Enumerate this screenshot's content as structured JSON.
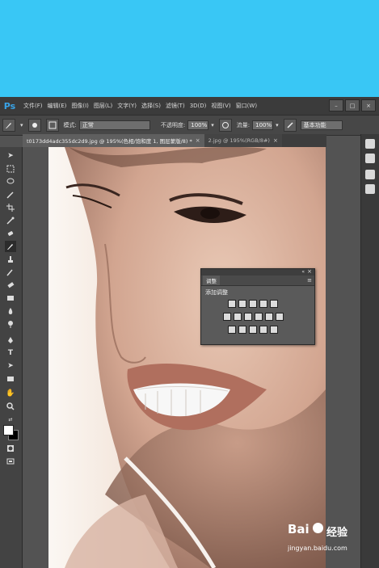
{
  "app": {
    "logo": "Ps"
  },
  "menu": [
    "文件(F)",
    "编辑(E)",
    "图像(I)",
    "图层(L)",
    "文字(Y)",
    "选择(S)",
    "滤镜(T)",
    "3D(D)",
    "视图(V)",
    "窗口(W)"
  ],
  "window_controls": [
    "–",
    "□",
    "×"
  ],
  "options": {
    "mode_label": "模式:",
    "mode_value": "正常",
    "opacity_label": "不透明度:",
    "opacity_value": "100%",
    "flow_label": "流量:",
    "flow_value": "100%",
    "workspace": "基本功能"
  },
  "tabs": [
    {
      "label": "t0173dd4adc355dc2d9.jpg @ 195%(色相/饱和度 1, 图层蒙版/8) *",
      "close": "×"
    },
    {
      "label": "2.jpg @ 195%(RGB/8#)",
      "close": "×"
    }
  ],
  "adjustments_panel": {
    "tab": "调整",
    "title": "添加调整",
    "rows": [
      [
        "brightness-contrast-icon",
        "levels-icon",
        "curves-icon",
        "exposure-icon",
        "vibrance-icon"
      ],
      [
        "hue-saturation-icon",
        "color-balance-icon",
        "black-white-icon",
        "photo-filter-icon",
        "channel-mixer-icon",
        "color-lookup-icon"
      ],
      [
        "invert-icon",
        "posterize-icon",
        "threshold-icon",
        "gradient-map-icon",
        "selective-color-icon"
      ]
    ]
  },
  "watermark": {
    "brand": "Bai",
    "brand2": "经验",
    "url": "jingyan.baidu.com"
  },
  "colors": {
    "background": "#39c7f5",
    "chrome": "#535353",
    "menubar": "#3b3b3b",
    "accent": "#39a4e8"
  }
}
